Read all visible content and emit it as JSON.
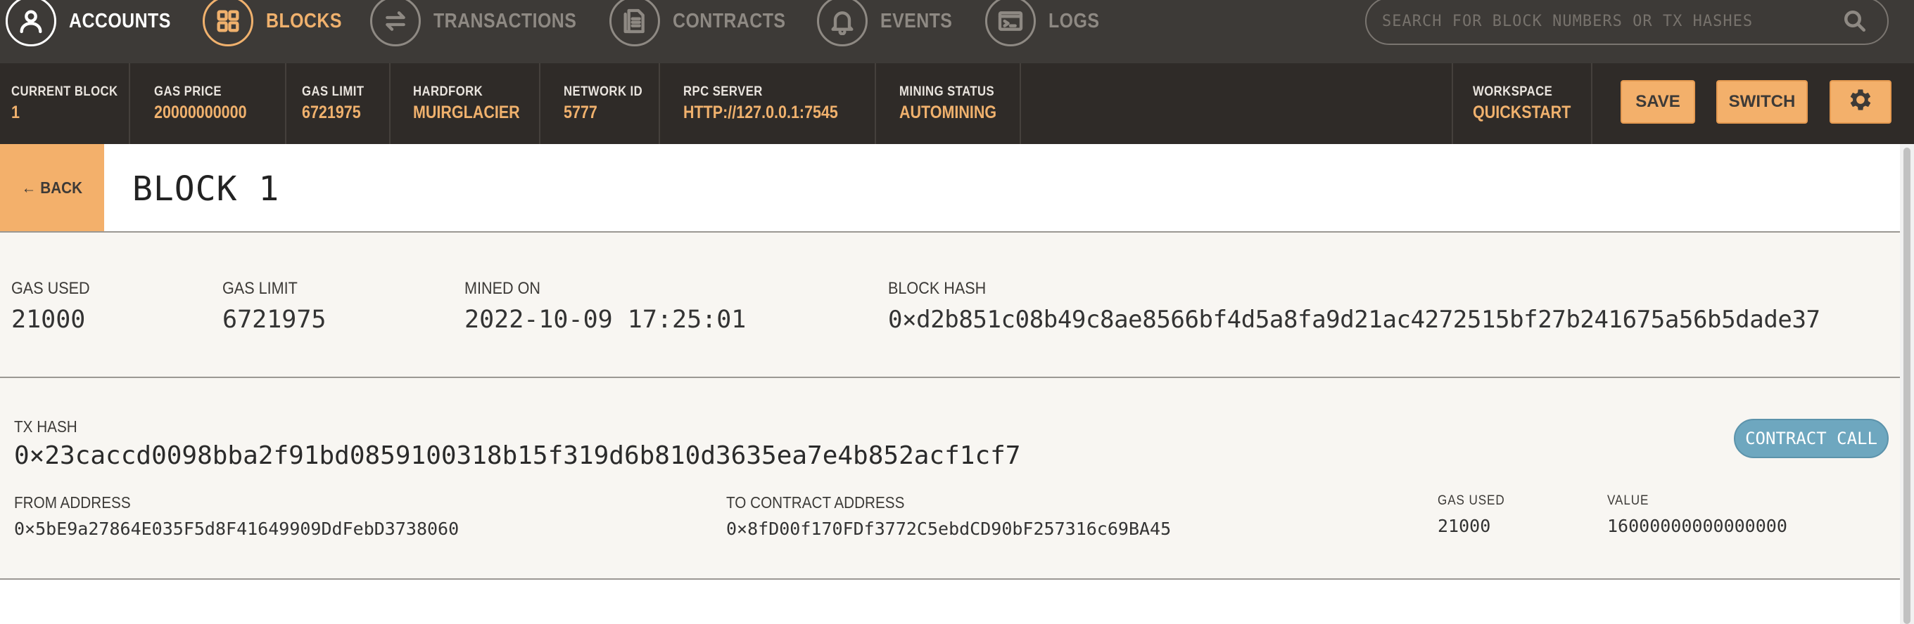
{
  "nav": {
    "items": [
      {
        "label": "ACCOUNTS",
        "icon": "account-icon"
      },
      {
        "label": "BLOCKS",
        "icon": "blocks-icon"
      },
      {
        "label": "TRANSACTIONS",
        "icon": "transactions-icon"
      },
      {
        "label": "CONTRACTS",
        "icon": "contracts-icon"
      },
      {
        "label": "EVENTS",
        "icon": "bell-icon"
      },
      {
        "label": "LOGS",
        "icon": "terminal-icon"
      }
    ],
    "active": "BLOCKS",
    "search_placeholder": "SEARCH FOR BLOCK NUMBERS OR TX HASHES"
  },
  "status": {
    "current_block": {
      "label": "CURRENT BLOCK",
      "value": "1"
    },
    "gas_price": {
      "label": "GAS PRICE",
      "value": "20000000000"
    },
    "gas_limit": {
      "label": "GAS LIMIT",
      "value": "6721975"
    },
    "hardfork": {
      "label": "HARDFORK",
      "value": "MUIRGLACIER"
    },
    "network_id": {
      "label": "NETWORK ID",
      "value": "5777"
    },
    "rpc_server": {
      "label": "RPC SERVER",
      "value": "HTTP://127.0.0.1:7545"
    },
    "mining_status": {
      "label": "MINING STATUS",
      "value": "AUTOMINING"
    },
    "workspace": {
      "label": "WORKSPACE",
      "value": "QUICKSTART"
    },
    "save_label": "SAVE",
    "switch_label": "SWITCH"
  },
  "block": {
    "back_label": "← BACK",
    "title": "BLOCK 1",
    "gas_used": {
      "label": "GAS USED",
      "value": "21000"
    },
    "gas_limit": {
      "label": "GAS LIMIT",
      "value": "6721975"
    },
    "mined_on": {
      "label": "MINED ON",
      "value": "2022-10-09 17:25:01"
    },
    "block_hash": {
      "label": "BLOCK HASH",
      "value": "0×d2b851c08b49c8ae8566bf4d5a8fa9d21ac4272515bf27b241675a56b5dade37"
    }
  },
  "transaction": {
    "tx_hash_label": "TX HASH",
    "tx_hash": "0×23caccd0098bba2f91bd0859100318b15f319d6b810d3635ea7e4b852acf1cf7",
    "type_badge": "CONTRACT CALL",
    "from_label": "FROM ADDRESS",
    "from_address": "0×5bE9a27864E035F5d8F41649909DdFebD3738060",
    "to_label": "TO CONTRACT ADDRESS",
    "to_address": "0×8fD00f170FDf3772C5ebdCD90bF257316c69BA45",
    "gas_used_label": "GAS USED",
    "gas_used": "21000",
    "value_label": "VALUE",
    "value": "16000000000000000"
  },
  "colors": {
    "nav_bg": "#3d3a37",
    "status_bg": "#2f2b28",
    "accent": "#f3b06b",
    "badge": "#6ea7bf",
    "panel_bg": "#f8f6f2"
  }
}
